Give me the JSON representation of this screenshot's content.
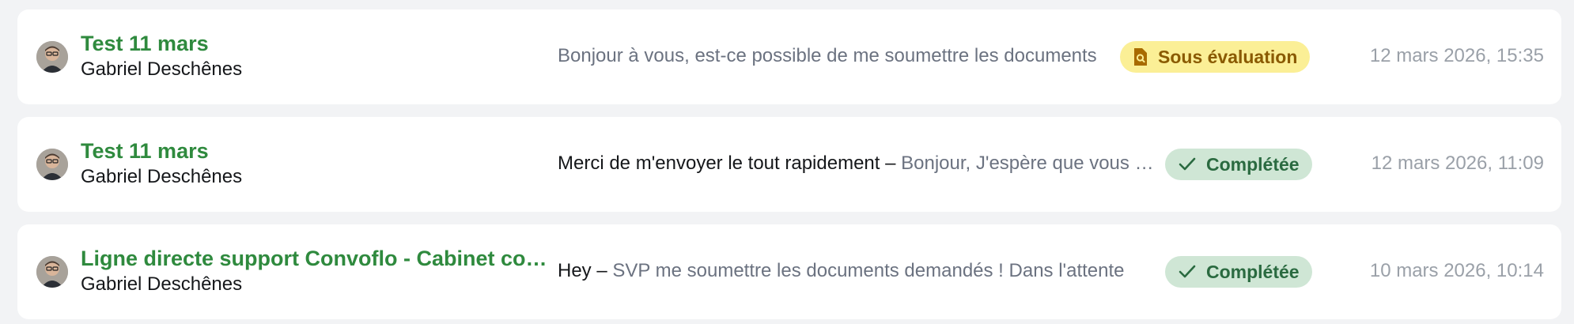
{
  "conversations": [
    {
      "title": "Test 11 mars",
      "author": "Gabriel Deschênes",
      "subject": "",
      "preview": "Bonjour à vous, est-ce possible de me soumettre les documents",
      "status": {
        "label": "Sous évaluation",
        "icon": "document-search-icon",
        "color": "#fbef96"
      },
      "date": "12 mars 2026, 15:35"
    },
    {
      "title": "Test 11 mars",
      "author": "Gabriel Deschênes",
      "subject": "Merci de m'envoyer le tout rapidement – ",
      "preview": "Bonjour, J'espère que vous allez bien",
      "status": {
        "label": "Complétée",
        "icon": "check-icon",
        "color": "#cfe6d5"
      },
      "date": "12 mars 2026, 11:09"
    },
    {
      "title": "Ligne directe support Convoflo - Cabinet comptable",
      "author": "Gabriel Deschênes",
      "subject": "Hey – ",
      "preview": "SVP me soumettre les documents demandés ! Dans l'attente",
      "status": {
        "label": "Complétée",
        "icon": "check-icon",
        "color": "#cfe6d5"
      },
      "date": "10 mars 2026, 10:14"
    }
  ]
}
